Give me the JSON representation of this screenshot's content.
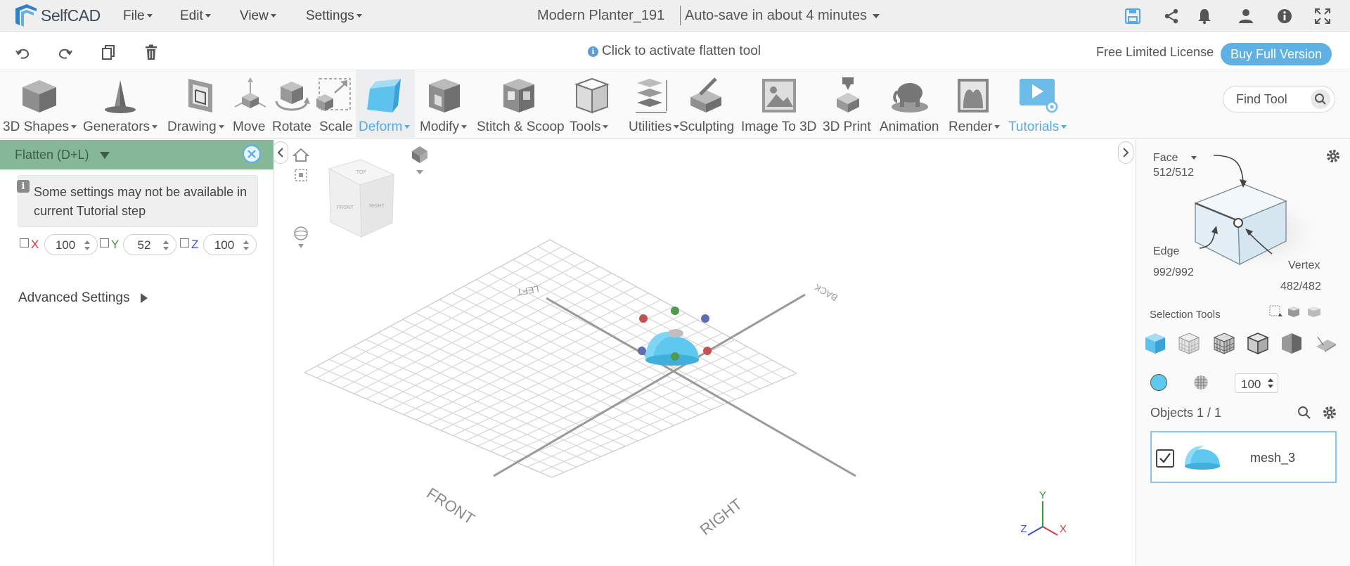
{
  "app": {
    "name": "SelfCAD",
    "project_title": "Modern Planter_191",
    "autosave": "Auto-save in about 4 minutes"
  },
  "menu": [
    "File",
    "Edit",
    "View",
    "Settings"
  ],
  "subbar": {
    "hint": "Click to activate flatten tool",
    "license": "Free Limited License",
    "buy": "Buy Full Version"
  },
  "tools": [
    {
      "label": "3D Shapes",
      "dropdown": true
    },
    {
      "label": "Generators",
      "dropdown": true
    },
    {
      "label": "Drawing",
      "dropdown": true
    },
    {
      "label": "Move",
      "dropdown": false
    },
    {
      "label": "Rotate",
      "dropdown": false
    },
    {
      "label": "Scale",
      "dropdown": false
    },
    {
      "label": "Deform",
      "dropdown": true,
      "active": true
    },
    {
      "label": "Modify",
      "dropdown": true
    },
    {
      "label": "Stitch & Scoop",
      "dropdown": false
    },
    {
      "label": "Tools",
      "dropdown": true
    },
    {
      "label": "Utilities",
      "dropdown": true
    },
    {
      "label": "Sculpting",
      "dropdown": false
    },
    {
      "label": "Image To 3D",
      "dropdown": false
    },
    {
      "label": "3D Print",
      "dropdown": false
    },
    {
      "label": "Animation",
      "dropdown": false
    },
    {
      "label": "Render",
      "dropdown": true
    },
    {
      "label": "Tutorials",
      "dropdown": true
    }
  ],
  "find_tool": {
    "placeholder": "Find Tool"
  },
  "left_panel": {
    "title": "Flatten (D+L)",
    "tip": "Some settings may not be available in current Tutorial step",
    "axes": [
      {
        "label": "X",
        "value": "100",
        "color": "#d23b3b"
      },
      {
        "label": "Y",
        "value": "52",
        "color": "#3a9a3a"
      },
      {
        "label": "Z",
        "value": "100",
        "color": "#3b4fd2"
      }
    ],
    "advanced": "Advanced Settings"
  },
  "viewport": {
    "grid_labels": {
      "front": "FRONT",
      "right": "RIGHT",
      "left": "LEFT",
      "back": "BACK"
    },
    "axis_gizmo": {
      "x": "X",
      "y": "Y",
      "z": "Z"
    },
    "cube_labels": {
      "top": "TOP",
      "front": "FRONT",
      "right": "RIGHT"
    }
  },
  "right_panel": {
    "face_label": "Face",
    "face_count": "512/512",
    "edge_label": "Edge",
    "edge_count": "992/992",
    "vertex_label": "Vertex",
    "vertex_count": "482/482",
    "selection_tools": "Selection Tools",
    "opacity": "100",
    "objects": "Objects 1 / 1",
    "object_name": "mesh_3"
  },
  "colors": {
    "accent": "#5aa8de",
    "panel_header": "#86b797",
    "object_blue": "#5ec8ee"
  }
}
